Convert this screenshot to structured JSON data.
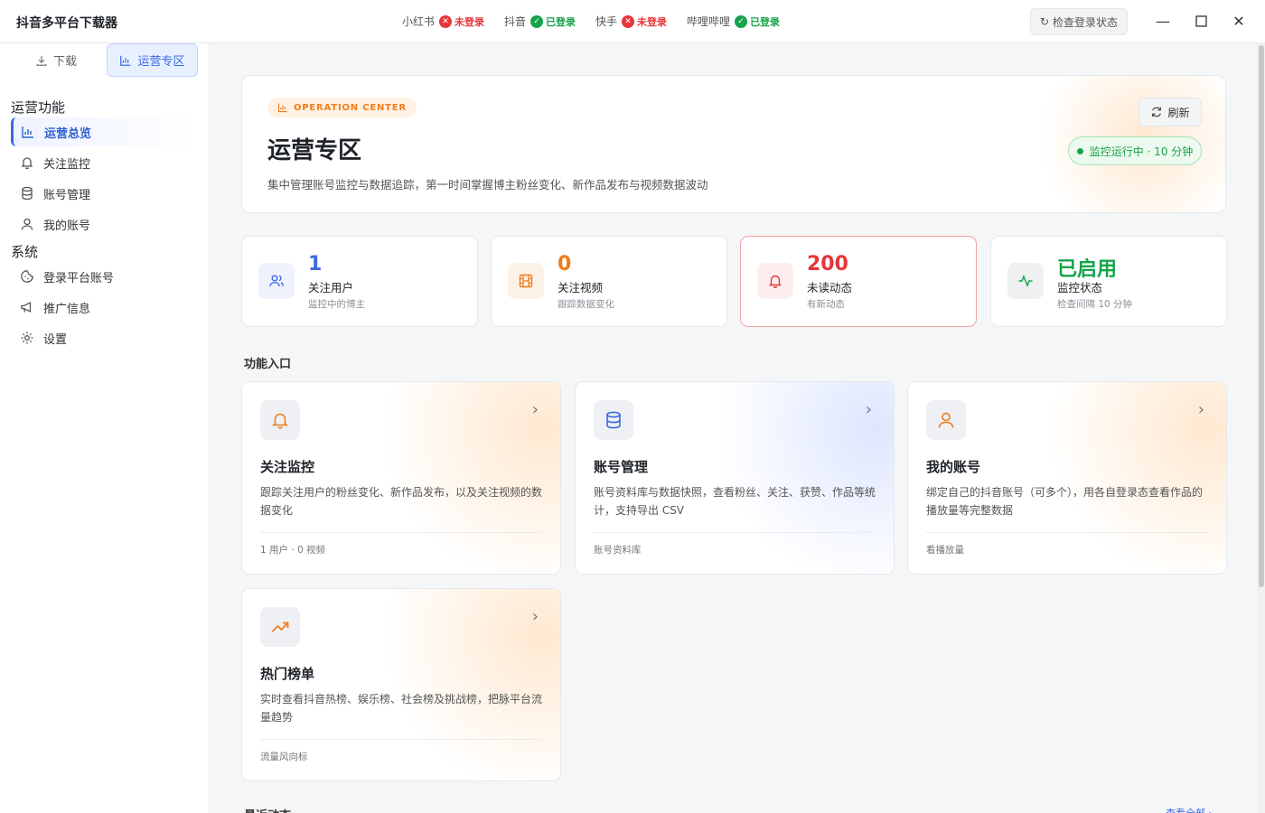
{
  "app": {
    "title": "抖音多平台下载器"
  },
  "platforms": [
    {
      "name": "小红书",
      "status": "未登录",
      "logged_in": false
    },
    {
      "name": "抖音",
      "status": "已登录",
      "logged_in": true
    },
    {
      "name": "快手",
      "status": "未登录",
      "logged_in": false
    },
    {
      "name": "哔哩哔哩",
      "status": "已登录",
      "logged_in": true
    }
  ],
  "header": {
    "check_login_label": "检查登录状态"
  },
  "sidebar": {
    "tabs": [
      {
        "label": "下载"
      },
      {
        "label": "运营专区"
      }
    ],
    "sections": [
      {
        "title": "运营功能",
        "items": [
          {
            "label": "运营总览"
          },
          {
            "label": "关注监控"
          },
          {
            "label": "账号管理"
          },
          {
            "label": "我的账号"
          }
        ]
      },
      {
        "title": "系统",
        "items": [
          {
            "label": "登录平台账号"
          },
          {
            "label": "推广信息"
          },
          {
            "label": "设置"
          }
        ]
      }
    ]
  },
  "hero": {
    "badge": "OPERATION CENTER",
    "title": "运营专区",
    "description": "集中管理账号监控与数据追踪，第一时间掌握博主粉丝变化、新作品发布与视频数据波动",
    "refresh_label": "刷新",
    "monitor_status": "监控运行中 · 10 分钟"
  },
  "stats": [
    {
      "value": "1",
      "label": "关注用户",
      "sub": "监控中的博主",
      "color": "#3a6ae0"
    },
    {
      "value": "0",
      "label": "关注视频",
      "sub": "跟踪数据变化",
      "color": "#ef7d1a"
    },
    {
      "value": "200",
      "label": "未读动态",
      "sub": "有新动态",
      "color": "#e5363a"
    },
    {
      "value": "已启用",
      "label": "监控状态",
      "sub": "检查间隔 10 分钟",
      "color": "#16a34a"
    }
  ],
  "features": {
    "title": "功能入口",
    "cards": [
      {
        "title": "关注监控",
        "description": "跟踪关注用户的粉丝变化、新作品发布，以及关注视频的数据变化",
        "footer": "1 用户 · 0 视频"
      },
      {
        "title": "账号管理",
        "description": "账号资料库与数据快照，查看粉丝、关注、获赞、作品等统计，支持导出 CSV",
        "footer": "账号资料库"
      },
      {
        "title": "我的账号",
        "description": "绑定自己的抖音账号（可多个），用各自登录态查看作品的播放量等完整数据",
        "footer": "看播放量"
      },
      {
        "title": "热门榜单",
        "description": "实时查看抖音热榜、娱乐榜、社会榜及挑战榜，把脉平台流量趋势",
        "footer": "流量风向标"
      }
    ]
  },
  "recent": {
    "title": "最近动态",
    "link": "查看全部 ›"
  }
}
